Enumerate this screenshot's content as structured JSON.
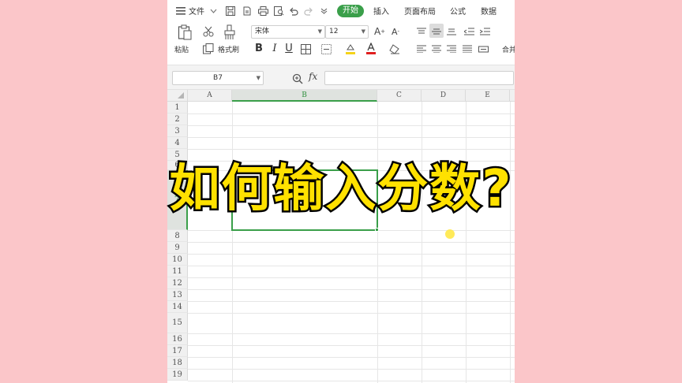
{
  "menubar": {
    "menu_icon": "hamburger-icon",
    "file_label": "文件",
    "tabs": [
      {
        "label": "开始",
        "active": true
      },
      {
        "label": "插入"
      },
      {
        "label": "页面布局"
      },
      {
        "label": "公式"
      },
      {
        "label": "数据"
      }
    ]
  },
  "ribbon": {
    "paste_label": "粘贴",
    "format_painter_label": "格式刷",
    "font_name": "宋体",
    "font_size": "12",
    "bold": "B",
    "italic": "I",
    "underline": "U",
    "merge_label": "合并"
  },
  "formula_bar": {
    "name_box": "B7",
    "fx_label": "fx",
    "formula_value": ""
  },
  "grid": {
    "columns": [
      "A",
      "B",
      "C",
      "D",
      "E"
    ],
    "active_column": "B",
    "rows": [
      "1",
      "2",
      "3",
      "4",
      "5",
      "6",
      "7",
      "8",
      "9",
      "10",
      "11",
      "12",
      "13",
      "14",
      "15",
      "16",
      "17",
      "18",
      "19"
    ],
    "selected_cell": "B7"
  },
  "overlay": {
    "title": "如何输入分数?"
  },
  "colors": {
    "accent": "#3a9f4a",
    "background": "#fbc6c9",
    "overlay_text": "#ffe100"
  }
}
